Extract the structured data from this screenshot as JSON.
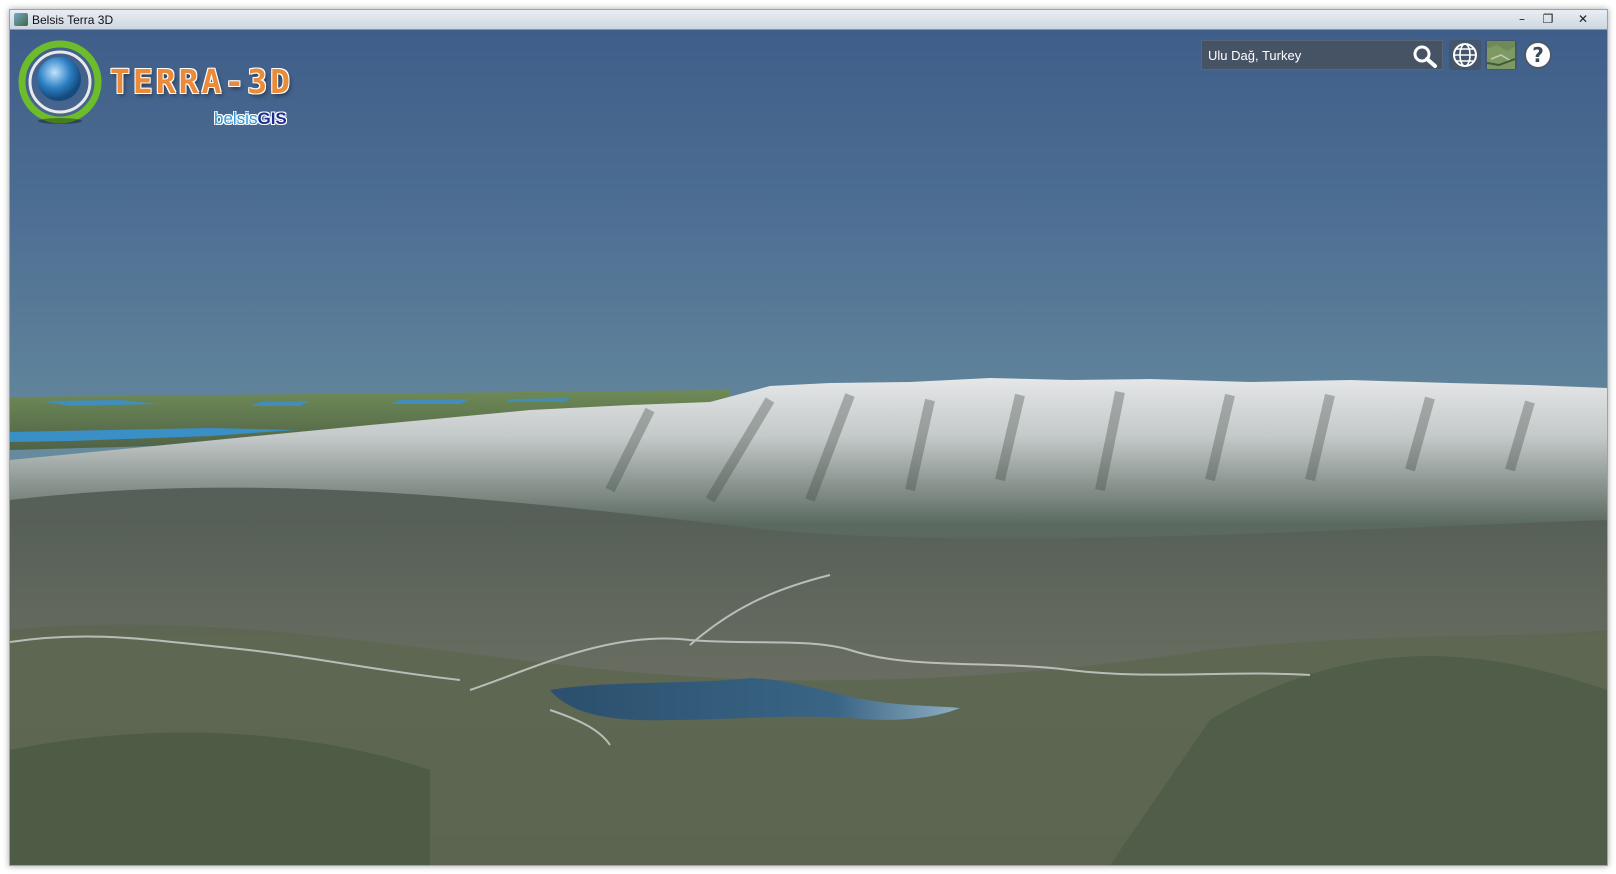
{
  "window": {
    "title": "Belsis Terra 3D",
    "minimize_glyph": "–",
    "restore_glyph": "❐",
    "close_glyph": "✕"
  },
  "logo": {
    "brand": "TERRA-3D",
    "sub_a": "belsis",
    "sub_b": "GIS"
  },
  "search": {
    "value": "Ulu Dağ, Turkey",
    "icon": "search-icon"
  },
  "toolbar": {
    "globe_icon": "globe-icon",
    "imagery_icon": "imagery-thumbnail-icon",
    "help_glyph": "?"
  },
  "colors": {
    "sky_top": "#3f5e8a",
    "sky_horizon": "#9cb79c",
    "snow": "#dfe2e3",
    "forest": "#4d5c4a",
    "lake": "#2f5878",
    "brand_orange": "#e98b3a",
    "brand_blue": "#1b2b8f"
  }
}
